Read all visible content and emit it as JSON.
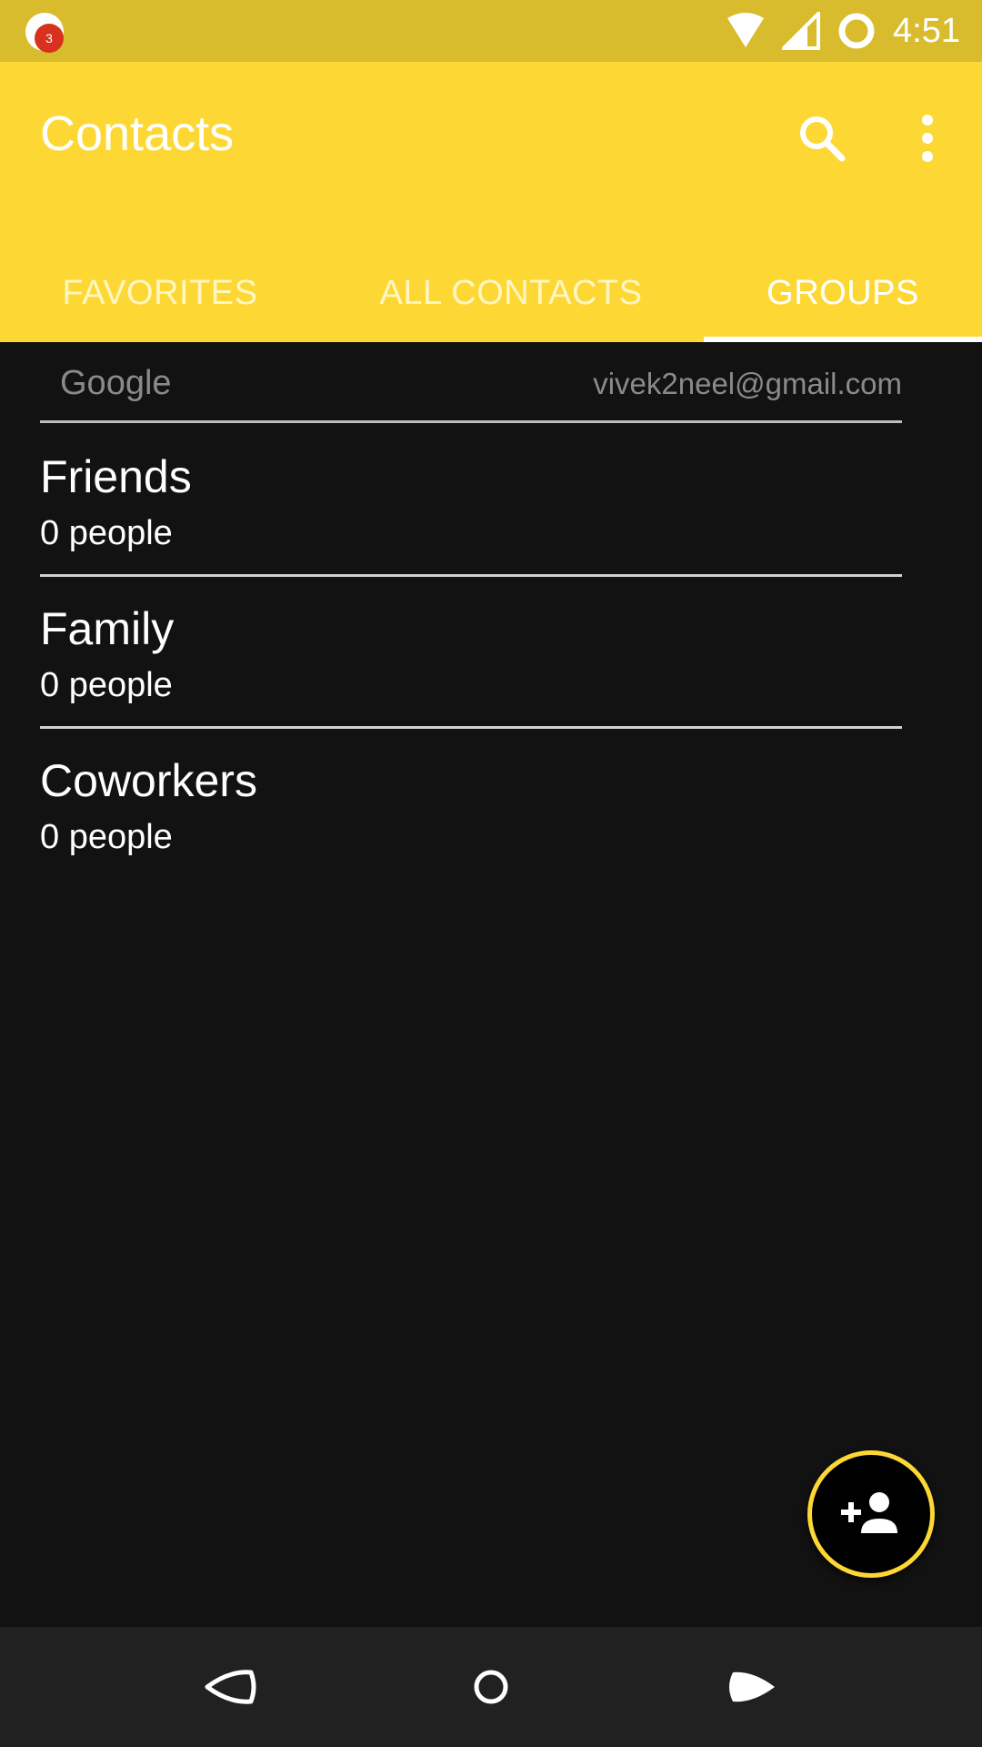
{
  "status_bar": {
    "notification_count": "3",
    "time": "4:51",
    "icons": [
      "wifi-icon",
      "signal-icon",
      "sync-icon"
    ]
  },
  "app_bar": {
    "title": "Contacts",
    "actions": [
      "search-icon",
      "more-vert-icon"
    ]
  },
  "tabs": [
    {
      "label": "FAVORITES",
      "selected": false
    },
    {
      "label": "ALL CONTACTS",
      "selected": false
    },
    {
      "label": "GROUPS",
      "selected": true
    }
  ],
  "account": {
    "type": "Google",
    "email": "vivek2neel@gmail.com"
  },
  "groups": [
    {
      "name": "Friends",
      "count": "0 people"
    },
    {
      "name": "Family",
      "count": "0 people"
    },
    {
      "name": "Coworkers",
      "count": "0 people"
    }
  ],
  "fab": {
    "icon": "add-person-icon"
  },
  "nav_bar": {
    "icons": [
      "back-icon",
      "home-icon",
      "recents-icon"
    ]
  },
  "colors": {
    "status_bar": "#D9BC2E",
    "app_bar": "#FDD835",
    "background": "#121212",
    "nav_bar": "#212121",
    "fab_border": "#FDD835",
    "badge": "#D8321E"
  }
}
